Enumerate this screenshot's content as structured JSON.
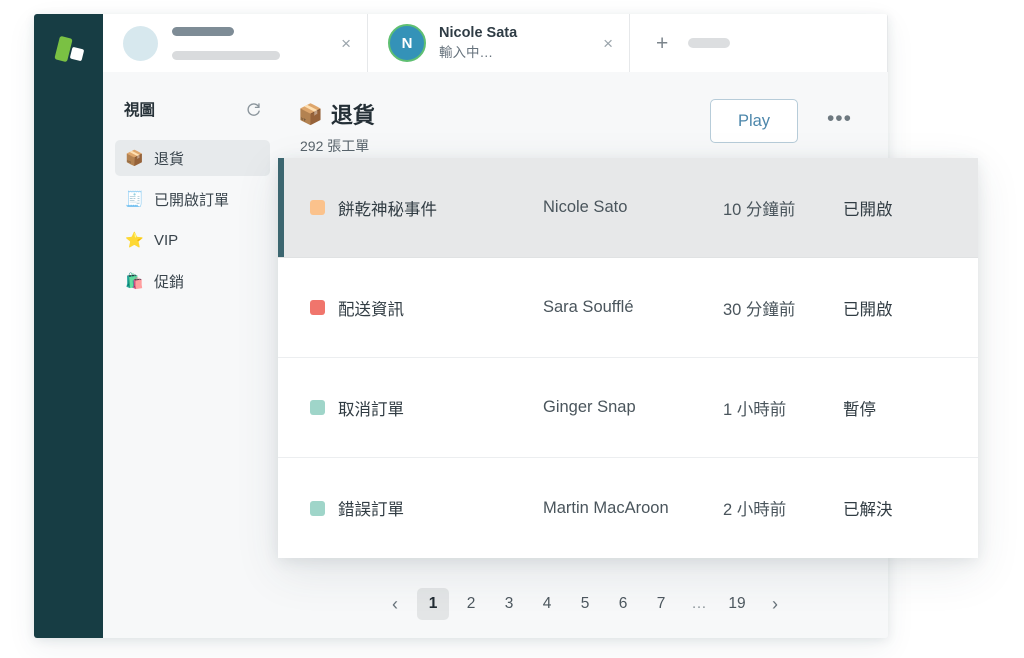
{
  "brand": {
    "logo_name": "app-logo",
    "rail_color": "#173d44",
    "accent_color": "#3c6670"
  },
  "tabs": [
    {
      "type": "skeleton",
      "close_label": "×"
    },
    {
      "type": "contact",
      "avatar_initial": "N",
      "title": "Nicole Sata",
      "subtitle": "輸入中…",
      "close_label": "×"
    },
    {
      "type": "new",
      "plus_label": "+"
    }
  ],
  "sidebar": {
    "title": "視圖",
    "refresh_icon": "refresh-icon",
    "items": [
      {
        "icon": "📦",
        "label": "退貨",
        "active": true
      },
      {
        "icon": "🧾",
        "label": "已開啟訂單",
        "active": false
      },
      {
        "icon": "⭐",
        "label": "VIP",
        "active": false
      },
      {
        "icon": "🛍️",
        "label": "促銷",
        "active": false
      }
    ]
  },
  "header": {
    "icon": "📦",
    "title": "退貨",
    "subtitle": "292 張工單",
    "play_label": "Play",
    "more_label": "•••"
  },
  "list": {
    "rows": [
      {
        "color": "#fbc28c",
        "subject": "餅乾神秘事件",
        "name": "Nicole Sato",
        "time": "10 分鐘前",
        "status": "已開啟",
        "selected": true
      },
      {
        "color": "#f0756c",
        "subject": "配送資訊",
        "name": "Sara Soufflé",
        "time": "30 分鐘前",
        "status": "已開啟",
        "selected": false
      },
      {
        "color": "#9fd5c9",
        "subject": "取消訂單",
        "name": "Ginger Snap",
        "time": "1 小時前",
        "status": "暫停",
        "selected": false
      },
      {
        "color": "#9fd5c9",
        "subject": "錯誤訂單",
        "name": "Martin MacAroon",
        "time": "2 小時前",
        "status": "已解決",
        "selected": false
      }
    ]
  },
  "pagination": {
    "prev_label": "‹",
    "next_label": "›",
    "pages": [
      "1",
      "2",
      "3",
      "4",
      "5",
      "6",
      "7",
      "…",
      "19"
    ],
    "current": "1"
  }
}
